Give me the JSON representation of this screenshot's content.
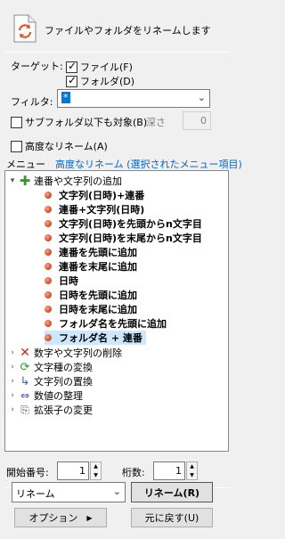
{
  "header": {
    "description": "ファイルやフォルダをリネームします"
  },
  "target": {
    "label": "ターゲット:",
    "file_label": "ファイル(F)",
    "folder_label": "フォルダ(D)"
  },
  "filter": {
    "label": "フィルタ:",
    "value": "*"
  },
  "subfolder": {
    "label": "サブフォルダ以下も対象(B)",
    "depth_label": "深さ",
    "depth_value": "0"
  },
  "advanced": {
    "label": "高度なリネーム(A)"
  },
  "menu": {
    "label": "メニュー",
    "advanced_title": "高度なリネーム (選択されたメニュー項目)"
  },
  "tree": {
    "group1": {
      "label": "連番や文字列の追加",
      "children": [
        "文字列(日時)+連番",
        "連番+文字列(日時)",
        "文字列(日時)を先頭からn文字目",
        "文字列(日時)を末尾からn文字目",
        "連番を先頭に追加",
        "連番を末尾に追加",
        "日時",
        "日時を先頭に追加",
        "日時を末尾に追加",
        "フォルダ名を先頭に追加",
        "フォルダ名 + 連番"
      ]
    },
    "groups": [
      {
        "label": "数字や文字列の削除",
        "icon": "red-x-icon"
      },
      {
        "label": "文字種の変換",
        "icon": "convert-icon"
      },
      {
        "label": "文字列の置換",
        "icon": "replace-icon"
      },
      {
        "label": "数値の整理",
        "icon": "number-icon"
      },
      {
        "label": "拡張子の変更",
        "icon": "extension-icon"
      }
    ]
  },
  "numbering": {
    "start_label": "開始番号:",
    "start_value": "1",
    "digits_label": "桁数:",
    "digits_value": "1"
  },
  "mode": {
    "value": "リネーム"
  },
  "buttons": {
    "rename": "リネーム(R)",
    "options": "オプション",
    "undo": "元に戻す(U)"
  }
}
